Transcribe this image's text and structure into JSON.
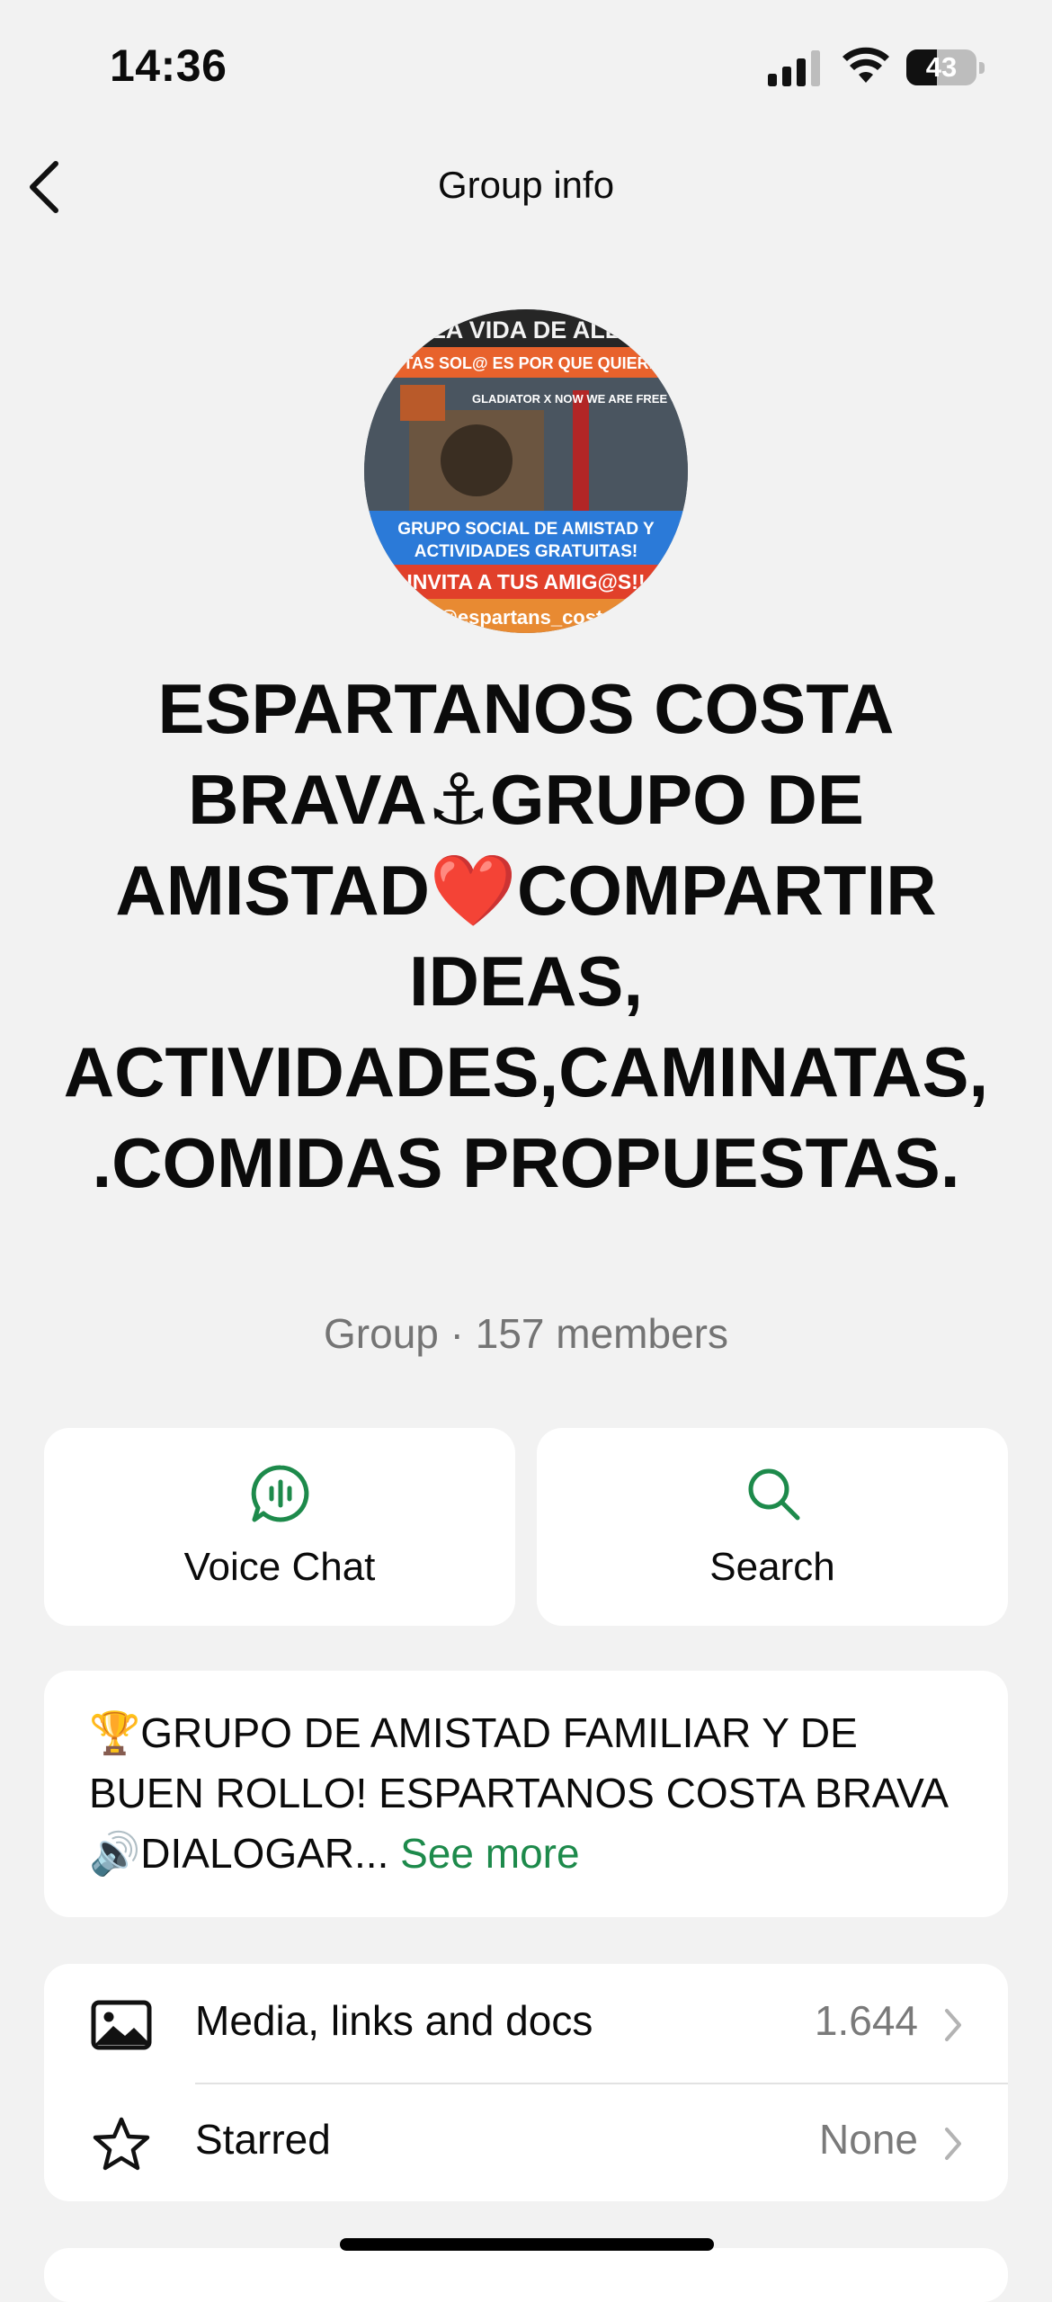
{
  "status_bar": {
    "time": "14:36",
    "battery_level": "43",
    "battery_fraction": 0.43
  },
  "nav": {
    "title": "Group info"
  },
  "avatar": {
    "banner_top": "VIVA LA VIDA DE ALEGRIA",
    "banner_line2": "ESTAS SOL@ ES POR QUE QUIERES",
    "poster_text": "GLADIATOR X NOW WE ARE FREE",
    "banner_blue": "GRUPO SOCIAL DE AMISTAD Y ACTIVIDADES GRATUITAS!",
    "banner_red": "INVITA A TUS AMIG@S!!",
    "bottom_text": "@espartans_costa"
  },
  "group": {
    "name": "ESPARTANOS COSTA BRAVA⚓GRUPO DE AMISTAD❤️COMPARTIR IDEAS, ACTIVIDADES,CAMINATAS,.COMIDAS PROPUESTAS.",
    "subtitle": "Group · 157 members"
  },
  "actions": {
    "voice_chat": {
      "label": "Voice Chat",
      "icon": "voice-chat-icon"
    },
    "search": {
      "label": "Search",
      "icon": "search-icon"
    }
  },
  "description": {
    "text": "🏆GRUPO DE AMISTAD FAMILIAR Y DE BUEN ROLLO! ESPARTANOS COSTA BRAVA 🔊DIALOGAR...",
    "see_more": "See more"
  },
  "list": [
    {
      "label": "Media, links and docs",
      "value": "1.644",
      "icon": "image-icon"
    },
    {
      "label": "Starred",
      "value": "None",
      "icon": "star-icon"
    }
  ],
  "colors": {
    "accent": "#1d8a4b",
    "background": "#f2f2f2",
    "card": "#ffffff"
  }
}
